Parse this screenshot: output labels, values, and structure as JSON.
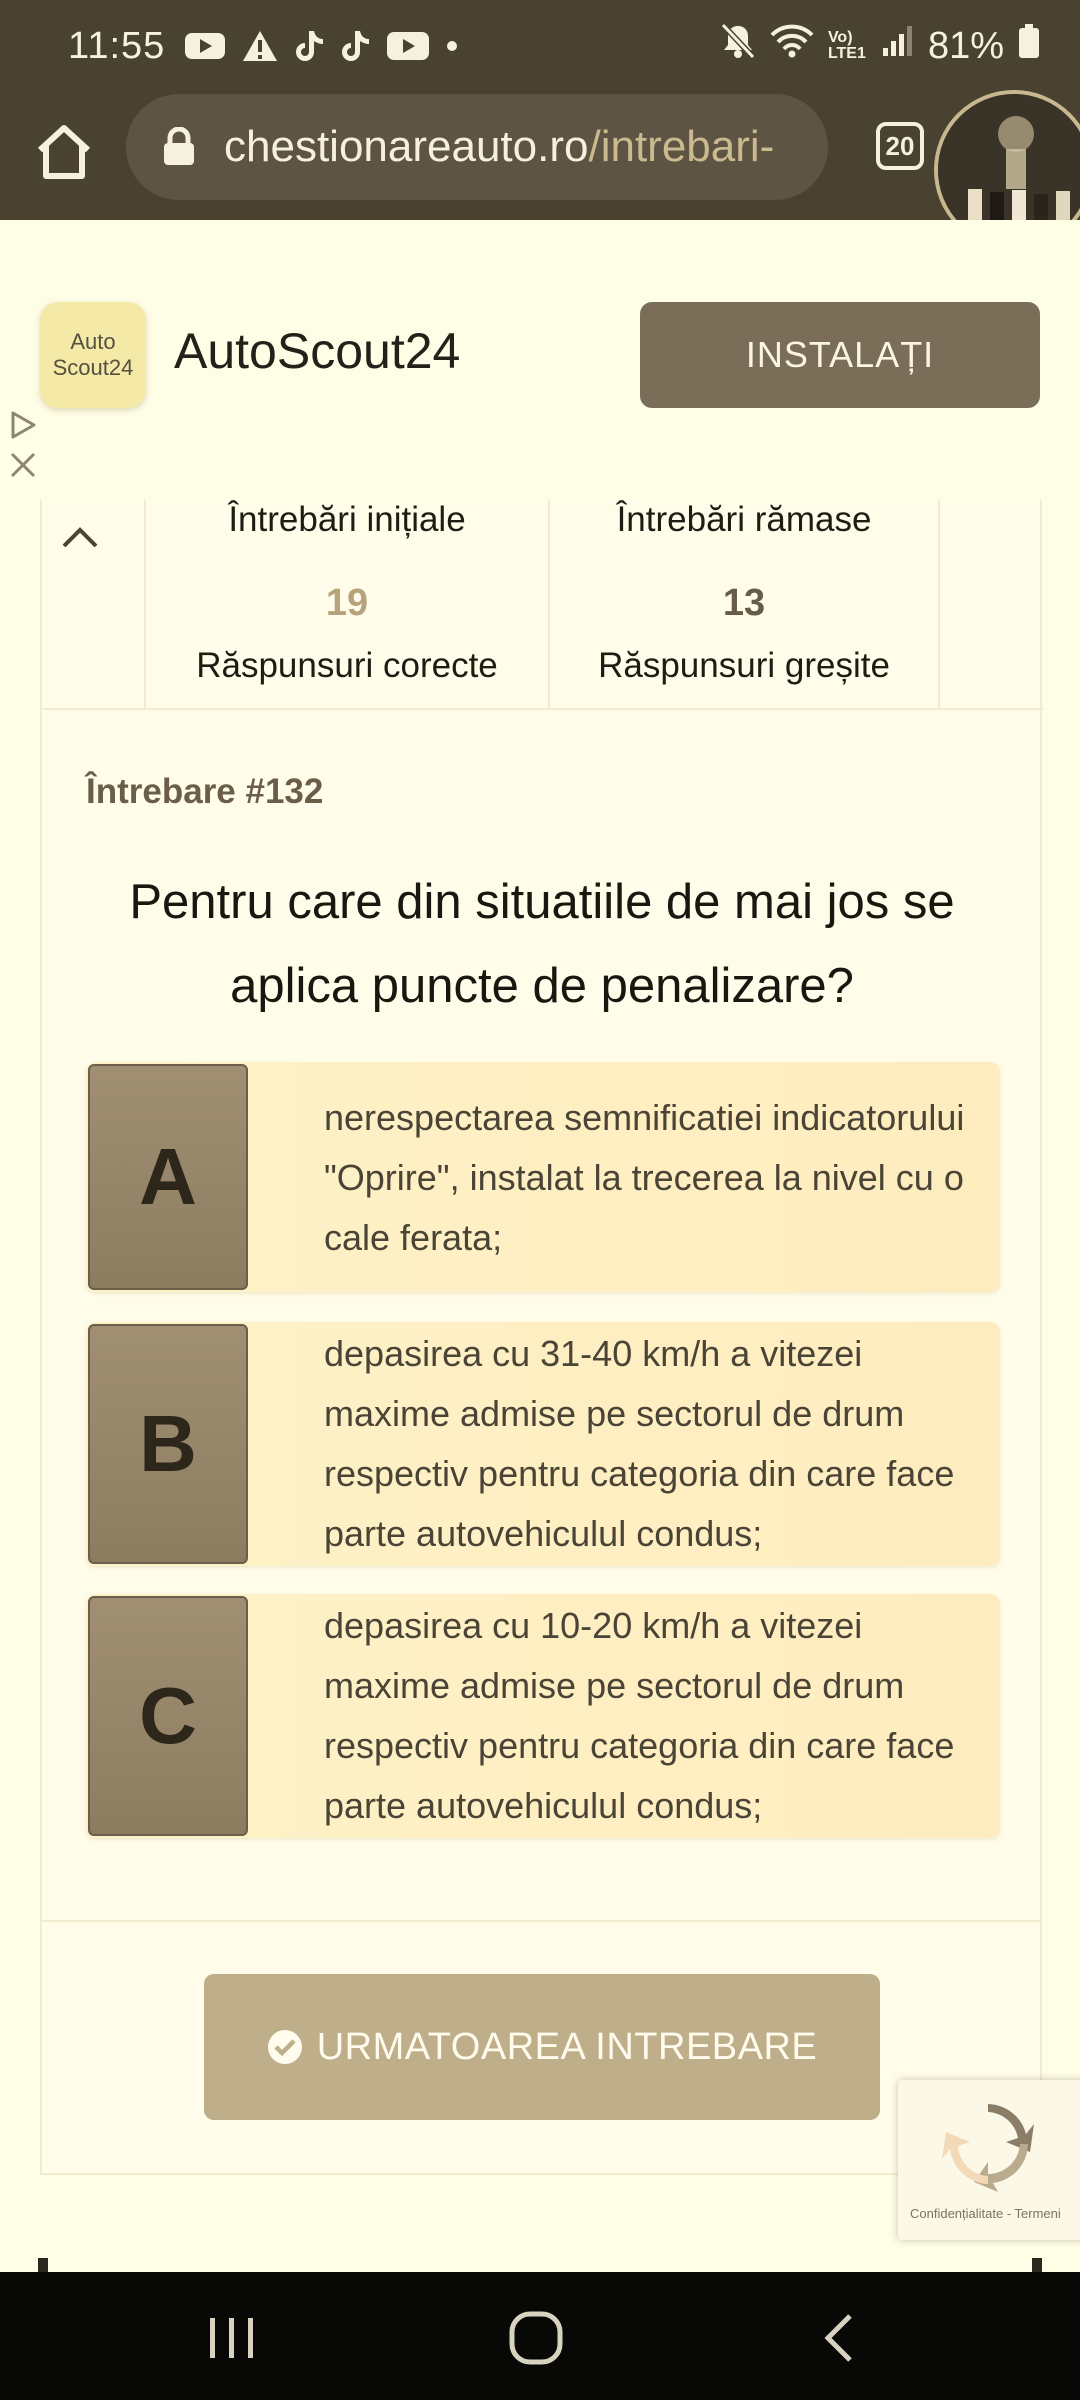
{
  "status_bar": {
    "time": "11:55",
    "network": "Vo) LTE1",
    "battery": "81%"
  },
  "browser": {
    "url_host": "chestionareauto.ro",
    "url_path": "/intrebari-",
    "tab_count": "20"
  },
  "ad": {
    "logo_line1": "Auto",
    "logo_line2": "Scout24",
    "title": "AutoScout24",
    "install_label": "INSTALAȚI"
  },
  "stats": {
    "initial_label": "Întrebări inițiale",
    "remaining_label": "Întrebări rămase",
    "correct_value": "19",
    "correct_label": "Răspunsuri corecte",
    "wrong_value": "13",
    "wrong_label": "Răspunsuri greșite"
  },
  "question": {
    "number": "Întrebare #132",
    "text": "Pentru care din situatiile de mai jos se aplica puncte de penalizare?"
  },
  "answers": [
    {
      "letter": "A",
      "text": "nerespectarea semnificatiei indicatorului \"Oprire\", instalat la trecerea la nivel cu o cale ferata;"
    },
    {
      "letter": "B",
      "text": "depasirea cu 31-40 km/h a vitezei maxime admise pe sectorul de drum respectiv pentru categoria din care face parte autovehiculul condus;"
    },
    {
      "letter": "C",
      "text": "depasirea cu 10-20 km/h a vitezei maxime admise pe sectorul de drum respectiv pentru categoria din care face parte autovehiculul condus;"
    }
  ],
  "next_button": {
    "label": "URMATOAREA INTREBARE"
  },
  "recaptcha": {
    "links": "Confidențialitate - Termeni"
  },
  "colors": {
    "status_bar_bg": "#4a4231",
    "page_bg": "#fefde5",
    "answer_bg": "#fff2c8",
    "answer_letter_bg": "#8c7c60",
    "next_button_bg": "#bfae8a",
    "correct_number": "#b6a37c",
    "wrong_number": "#675c48"
  }
}
